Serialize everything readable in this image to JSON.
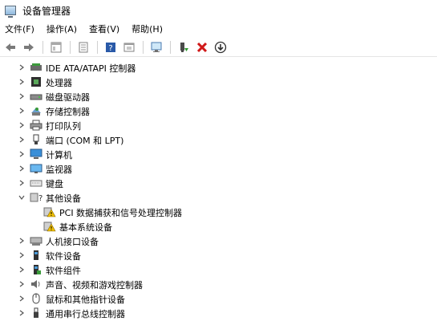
{
  "window": {
    "title": "设备管理器"
  },
  "menu": [
    "文件(F)",
    "操作(A)",
    "查看(V)",
    "帮助(H)"
  ],
  "toolbar": [
    {
      "name": "back-arrow-icon"
    },
    {
      "name": "forward-arrow-icon"
    },
    {
      "name": "properties-panel-icon"
    },
    {
      "name": "list-view-icon"
    },
    {
      "name": "help-icon"
    },
    {
      "name": "update-driver-icon"
    },
    {
      "name": "scan-hardware-icon"
    },
    {
      "name": "enable-device-icon"
    },
    {
      "name": "uninstall-x-icon"
    },
    {
      "name": "download-driver-icon"
    }
  ],
  "tree": [
    {
      "label": "IDE ATA/ATAPI 控制器",
      "icon": "ide-controller-icon",
      "state": "collapsed",
      "level": 0
    },
    {
      "label": "处理器",
      "icon": "processor-icon",
      "state": "collapsed",
      "level": 0
    },
    {
      "label": "磁盘驱动器",
      "icon": "disk-drive-icon",
      "state": "collapsed",
      "level": 0
    },
    {
      "label": "存储控制器",
      "icon": "storage-controller-icon",
      "state": "collapsed",
      "level": 0
    },
    {
      "label": "打印队列",
      "icon": "printer-icon",
      "state": "collapsed",
      "level": 0
    },
    {
      "label": "端口 (COM 和 LPT)",
      "icon": "port-icon",
      "state": "collapsed",
      "level": 0
    },
    {
      "label": "计算机",
      "icon": "computer-icon",
      "state": "collapsed",
      "level": 0
    },
    {
      "label": "监视器",
      "icon": "monitor-icon",
      "state": "collapsed",
      "level": 0
    },
    {
      "label": "键盘",
      "icon": "keyboard-icon",
      "state": "collapsed",
      "level": 0
    },
    {
      "label": "其他设备",
      "icon": "other-devices-icon",
      "state": "expanded",
      "level": 0
    },
    {
      "label": "PCI 数据捕获和信号处理控制器",
      "icon": "warning-device-icon",
      "state": "none",
      "level": 1
    },
    {
      "label": "基本系统设备",
      "icon": "warning-device-icon",
      "state": "none",
      "level": 1
    },
    {
      "label": "人机接口设备",
      "icon": "hid-icon",
      "state": "collapsed",
      "level": 0
    },
    {
      "label": "软件设备",
      "icon": "software-device-icon",
      "state": "collapsed",
      "level": 0
    },
    {
      "label": "软件组件",
      "icon": "software-component-icon",
      "state": "collapsed",
      "level": 0
    },
    {
      "label": "声音、视频和游戏控制器",
      "icon": "speaker-icon",
      "state": "collapsed",
      "level": 0
    },
    {
      "label": "鼠标和其他指针设备",
      "icon": "mouse-icon",
      "state": "collapsed",
      "level": 0
    },
    {
      "label": "通用串行总线控制器",
      "icon": "usb-icon",
      "state": "collapsed",
      "level": 0
    }
  ]
}
